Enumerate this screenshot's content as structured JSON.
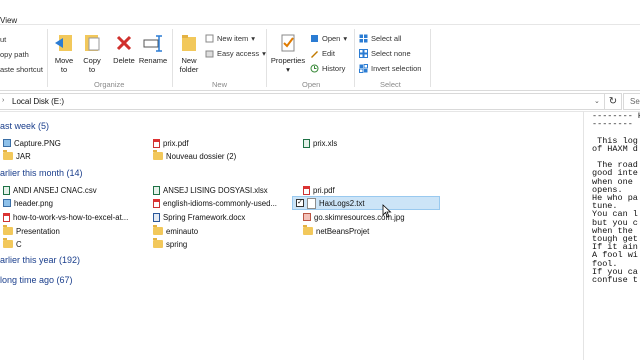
{
  "tabs": {
    "view": "View"
  },
  "ribbon": {
    "clipboard": {
      "cut": "ut",
      "copy_path": "opy path",
      "paste_shortcut": "aste shortcut"
    },
    "organize": {
      "move_to": [
        "Move",
        "to"
      ],
      "copy_to": [
        "Copy",
        "to"
      ],
      "delete": "Delete",
      "rename": "Rename",
      "group": "Organize"
    },
    "new": {
      "new_folder": [
        "New",
        "folder"
      ],
      "new_item": "New item",
      "easy_access": "Easy access",
      "group": "New"
    },
    "open": {
      "properties": "Properties",
      "open": "Open",
      "edit": "Edit",
      "history": "History",
      "group": "Open"
    },
    "select": {
      "select_all": "Select all",
      "select_none": "Select none",
      "invert_selection": "Invert selection",
      "group": "Select"
    }
  },
  "address": {
    "path": "Local Disk (E:)",
    "refresh": "↻",
    "search_placeholder": "Se"
  },
  "groups": [
    {
      "label": "ast week (5)"
    },
    {
      "label": "arlier this month (14)"
    },
    {
      "label": "arlier this year (192)"
    },
    {
      "label": " long time ago (67)"
    }
  ],
  "files": {
    "last_week": [
      "Capture.PNG",
      "prix.pdf",
      "prix.xls",
      "JAR",
      "Nouveau dossier (2)"
    ],
    "this_month": [
      "ANDI ANSEJ CNAC.csv",
      "ANSEJ LISING DOSYASI.xlsx",
      "pri.pdf",
      "header.png",
      "english-idioms-commonly-used...",
      "HaxLogs2.txt",
      "how-to-work-vs-how-to-excel-at...",
      "Spring Framework.docx",
      "go.skimresources.com.jpg",
      "Presentation",
      "eminauto",
      "netBeansProjet",
      "C",
      "spring"
    ]
  },
  "preview": "-------- H\n--------\n\n This log\nof HAXM d\n\n The road\ngood inte\nwhen one \nopens.\nHe who pa\ntune.\nYou can l\nbut you c\nwhen the \ntough get\nIf it ain\nA fool wi\nfool.\nIf you ca\nconfuse t"
}
